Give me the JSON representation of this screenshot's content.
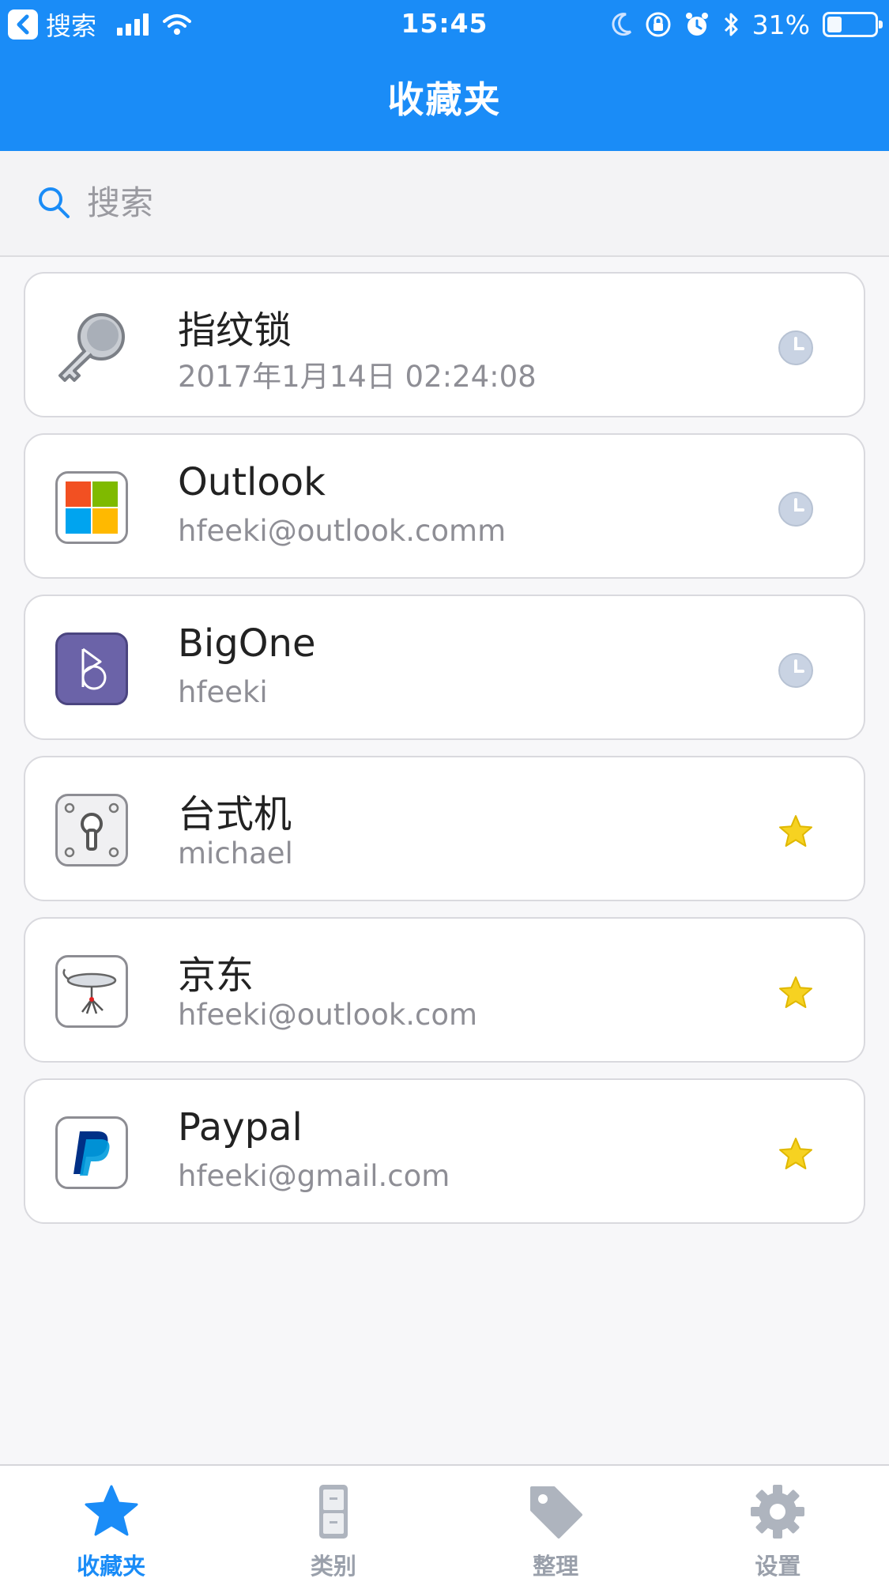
{
  "status_bar": {
    "back_app": "搜索",
    "time": "15:45",
    "battery_percent": "31%",
    "battery_level": 0.31
  },
  "nav": {
    "title": "收藏夹"
  },
  "search": {
    "placeholder": "搜索",
    "value": ""
  },
  "items": [
    {
      "title": "指纹锁",
      "subtitle": "2017年1月14日 02:24:08",
      "icon": "key-icon",
      "status": "clock-icon"
    },
    {
      "title": "Outlook",
      "subtitle": "hfeeki@outlook.comm",
      "icon": "outlook-logo-icon",
      "status": "clock-icon"
    },
    {
      "title": "BigOne",
      "subtitle": "hfeeki",
      "icon": "bigone-logo-icon",
      "status": "clock-icon"
    },
    {
      "title": "台式机",
      "subtitle": "michael",
      "icon": "keyhole-safe-icon",
      "status": "star-icon"
    },
    {
      "title": "京东",
      "subtitle": "hfeeki@outlook.com",
      "icon": "jd-logo-icon",
      "status": "star-icon"
    },
    {
      "title": "Paypal",
      "subtitle": "hfeeki@gmail.com",
      "icon": "paypal-logo-icon",
      "status": "star-icon"
    }
  ],
  "tabs": [
    {
      "label": "收藏夹",
      "icon": "star-icon",
      "active": true
    },
    {
      "label": "类别",
      "icon": "cabinet-icon",
      "active": false
    },
    {
      "label": "整理",
      "icon": "tag-icon",
      "active": false
    },
    {
      "label": "设置",
      "icon": "gear-icon",
      "active": false
    }
  ],
  "colors": {
    "accent": "#1a8cf7",
    "inactive_tab": "#9aa0ab",
    "star": "#f6d221",
    "clock": "#c9d3e3"
  }
}
